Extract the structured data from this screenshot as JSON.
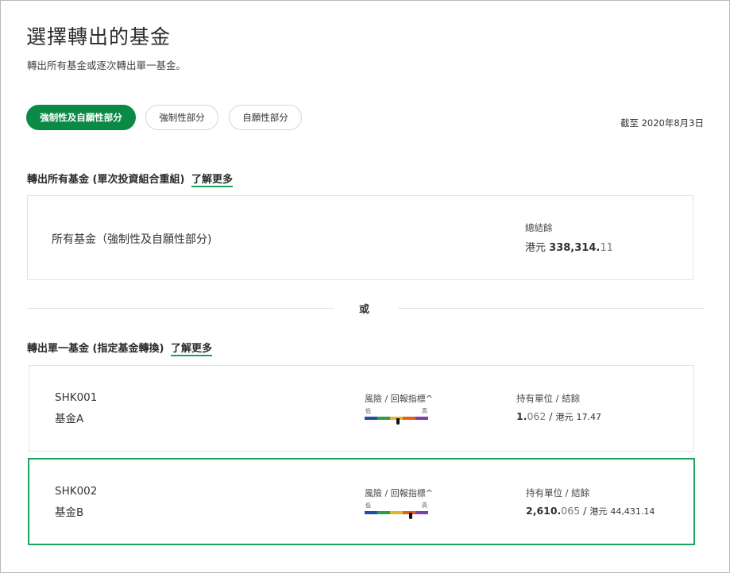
{
  "page": {
    "title": "選擇轉出的基金",
    "subtitle": "轉出所有基金或逐次轉出單一基金。"
  },
  "tabs": [
    {
      "label": "強制性及自願性部分",
      "active": true
    },
    {
      "label": "強制性部分",
      "active": false
    },
    {
      "label": "自願性部分",
      "active": false
    }
  ],
  "as_of": "截至 2020年8月3日",
  "all_funds": {
    "heading": "轉出所有基金 (單次投資組合重組)",
    "learn_more": "了解更多",
    "label": "所有基金（強制性及自願性部分)",
    "balance_label": "總結餘",
    "balance_currency": "港元",
    "balance_whole": "338,314.",
    "balance_decimal": "11"
  },
  "or_label": "或",
  "single_fund": {
    "heading": "轉出單一基金 (指定基金轉換)",
    "learn_more": "了解更多",
    "funds": [
      {
        "code": "SHK001",
        "name": "基金A",
        "risk_label": "風險 / 回報指標^",
        "risk_low": "低",
        "risk_high": "高",
        "risk_level": 0.52,
        "holdings_label": "持有單位 / 結餘",
        "units_whole": "1.",
        "units_decimal": "062",
        "separator": "/",
        "balance_currency": "港元",
        "balance": "17.47",
        "selected": false
      },
      {
        "code": "SHK002",
        "name": "基金B",
        "risk_label": "風險 / 回報指標^",
        "risk_low": "低",
        "risk_high": "高",
        "risk_level": 0.72,
        "holdings_label": "持有單位 / 結餘",
        "units_whole": "2,610.",
        "units_decimal": "065",
        "separator": "/",
        "balance_currency": "港元",
        "balance": "44,431.14",
        "selected": true
      }
    ]
  },
  "colors": {
    "accent": "#0b8a45",
    "selected_border": "#1aa35a",
    "risk_scale": [
      "#1f4fa3",
      "#2e9c4a",
      "#e2b62a",
      "#e0601f",
      "#7b3fa6"
    ]
  }
}
